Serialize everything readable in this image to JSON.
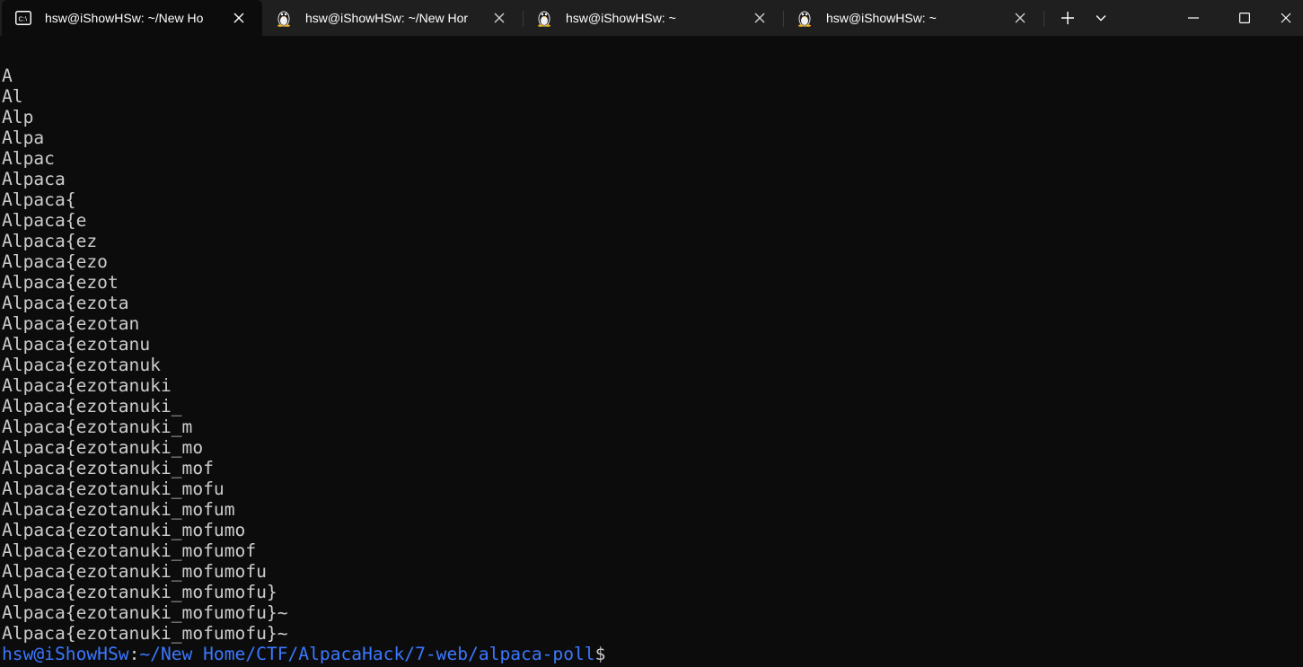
{
  "tabs": [
    {
      "title": "hsw@iShowHSw: ~/New Ho",
      "icon": "cmd-icon",
      "active": true
    },
    {
      "title": "hsw@iShowHSw: ~/New Hor",
      "icon": "linux-penguin-icon",
      "active": false
    },
    {
      "title": "hsw@iShowHSw: ~",
      "icon": "linux-penguin-icon",
      "active": false
    },
    {
      "title": "hsw@iShowHSw: ~",
      "icon": "linux-penguin-icon",
      "active": false
    }
  ],
  "terminal": {
    "lines": [
      "A",
      "Al",
      "Alp",
      "Alpa",
      "Alpac",
      "Alpaca",
      "Alpaca{",
      "Alpaca{e",
      "Alpaca{ez",
      "Alpaca{ezo",
      "Alpaca{ezot",
      "Alpaca{ezota",
      "Alpaca{ezotan",
      "Alpaca{ezotanu",
      "Alpaca{ezotanuk",
      "Alpaca{ezotanuki",
      "Alpaca{ezotanuki_",
      "Alpaca{ezotanuki_m",
      "Alpaca{ezotanuki_mo",
      "Alpaca{ezotanuki_mof",
      "Alpaca{ezotanuki_mofu",
      "Alpaca{ezotanuki_mofum",
      "Alpaca{ezotanuki_mofumo",
      "Alpaca{ezotanuki_mofumof",
      "Alpaca{ezotanuki_mofumofu",
      "Alpaca{ezotanuki_mofumofu}",
      "Alpaca{ezotanuki_mofumofu}~",
      "Alpaca{ezotanuki_mofumofu}~"
    ],
    "prompt": {
      "user_host": "hsw@iShowHSw",
      "colon": ":",
      "path": "~/New Home/CTF/AlpacaHack/7-web/alpaca-poll",
      "dollar": "$"
    }
  },
  "colors": {
    "background": "#0c0c0c",
    "tabbar": "#1f1f1f",
    "text": "#cccccc",
    "prompt_blue": "#3b78ff"
  }
}
